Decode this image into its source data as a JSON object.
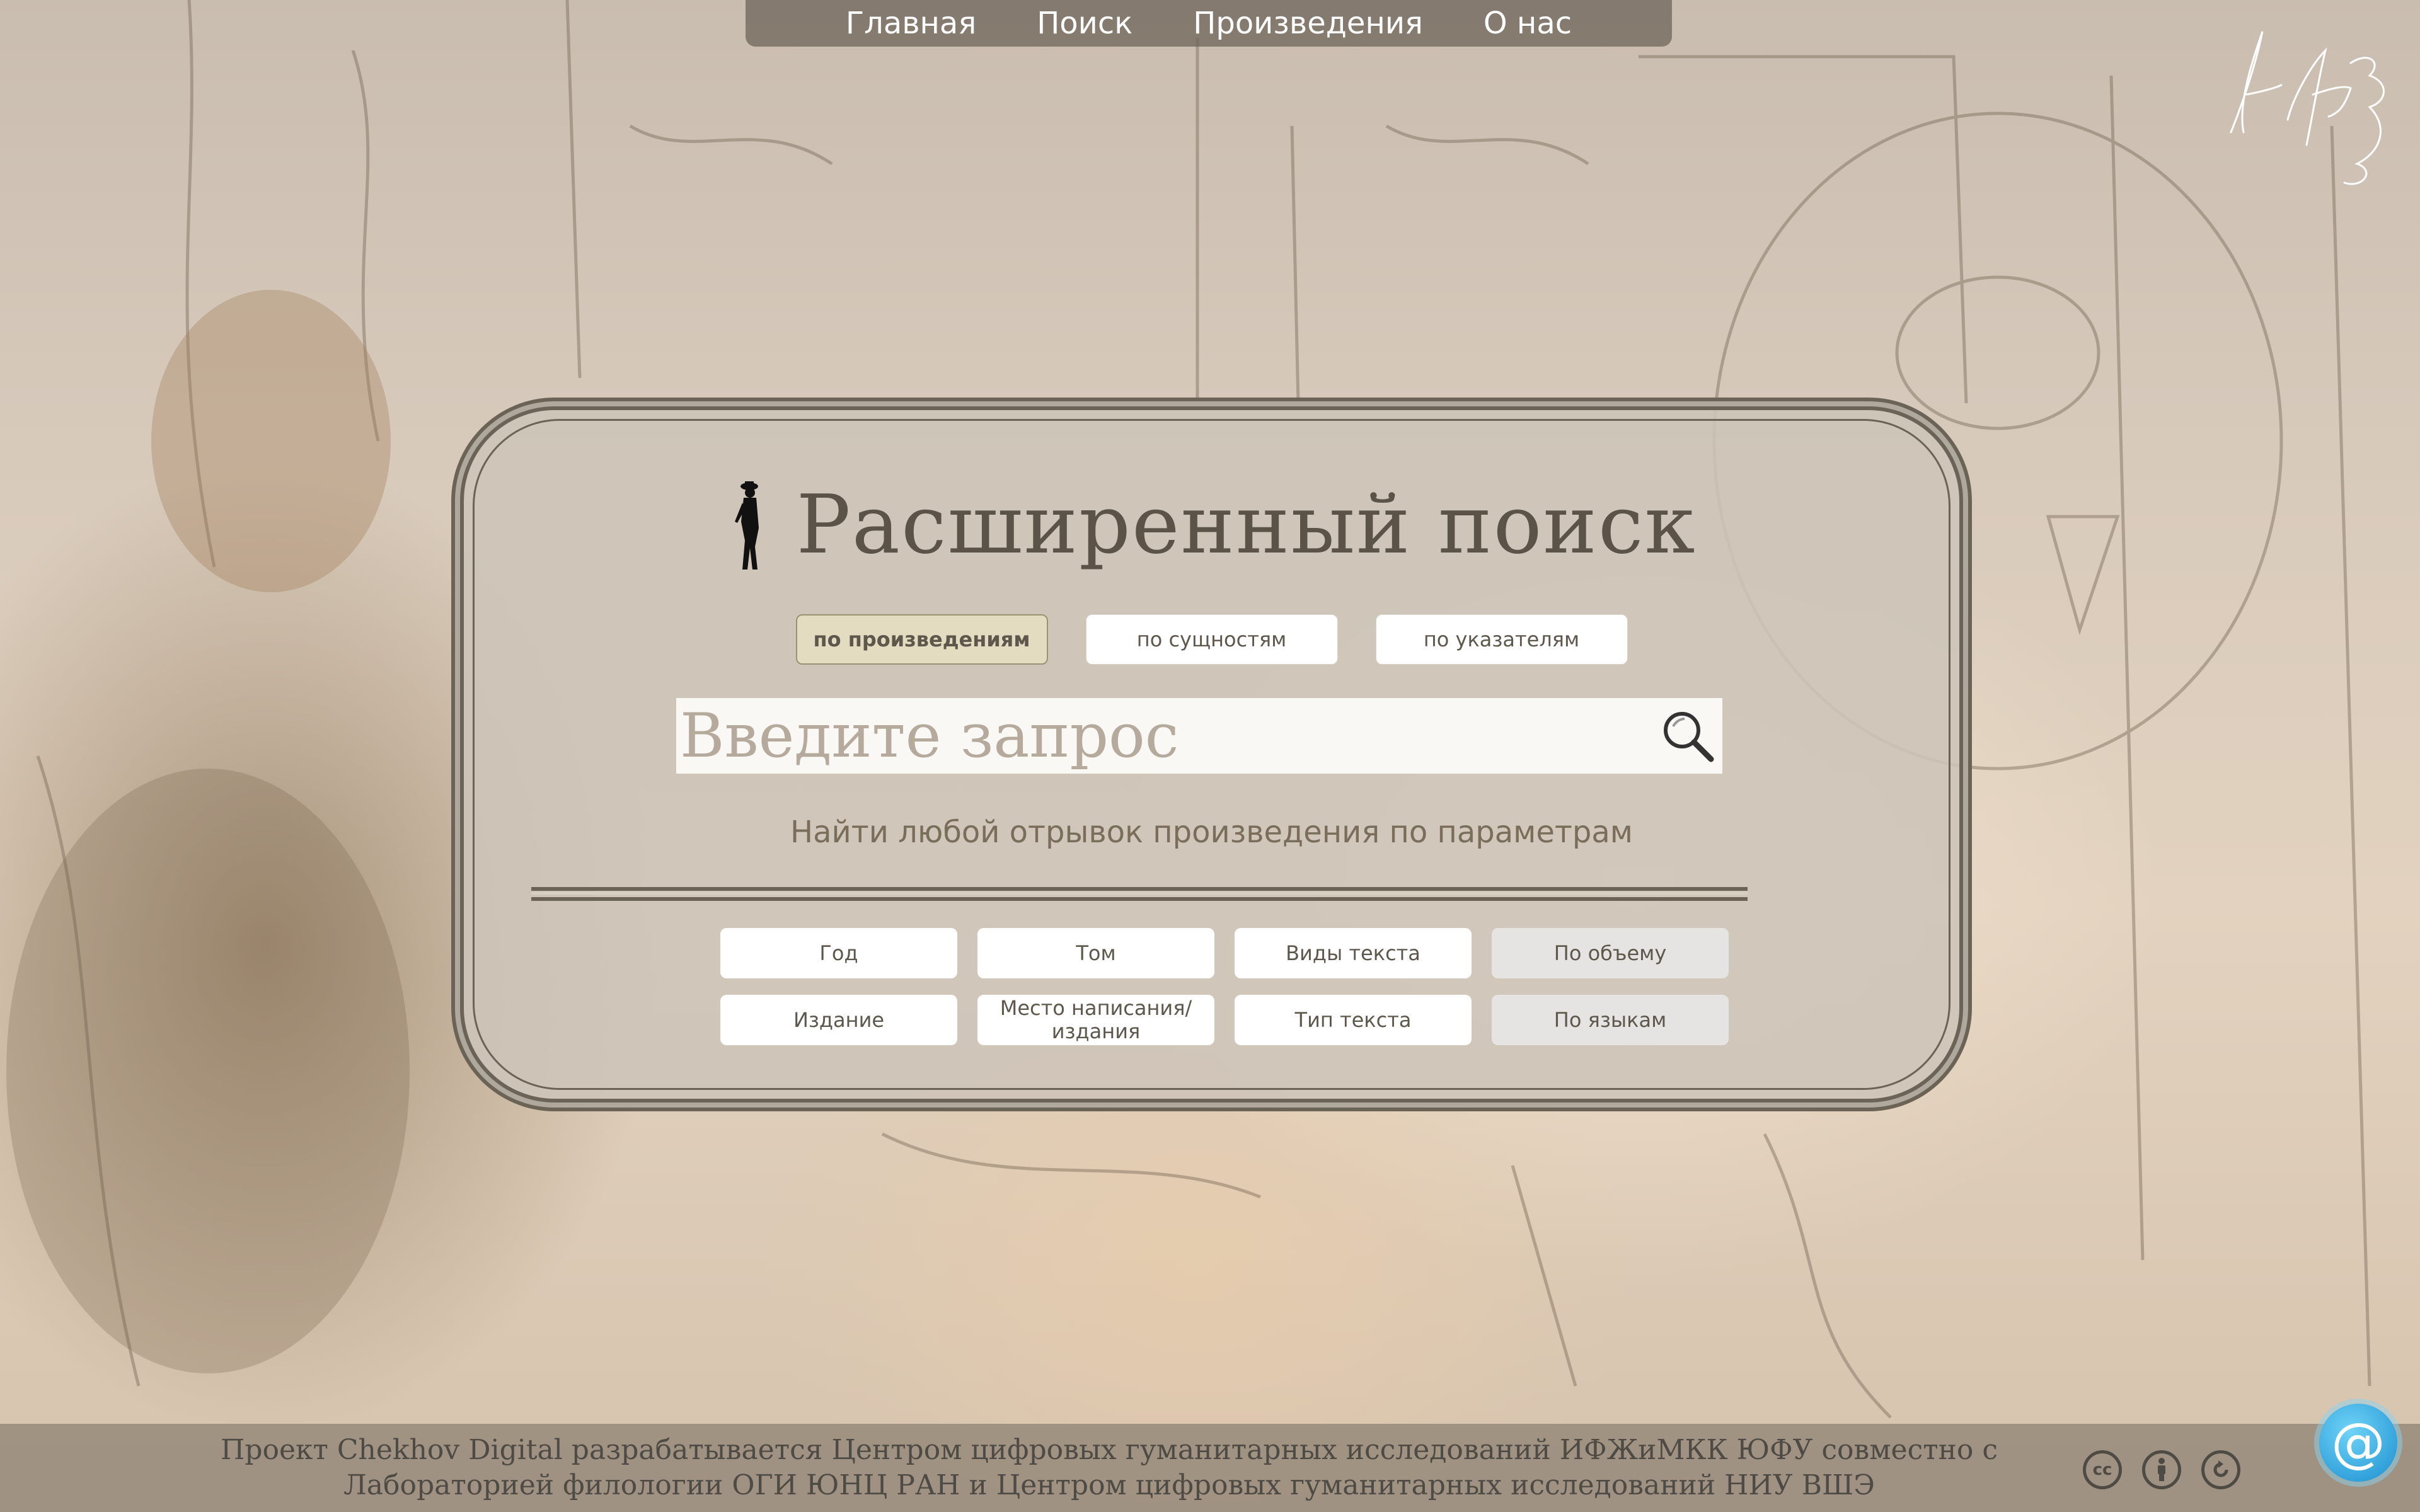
{
  "nav": {
    "items": [
      "Главная",
      "Поиск",
      "Произведения",
      "О нас"
    ]
  },
  "search_page": {
    "title": "Расширенный поиск",
    "tabs": [
      {
        "label": "по произведениям",
        "active": true
      },
      {
        "label": "по сущностям",
        "active": false
      },
      {
        "label": "по указателям",
        "active": false
      }
    ],
    "query": {
      "value": "",
      "placeholder": "Введите запрос"
    },
    "subtitle": "Найти любой отрывок произведения по параметрам",
    "filters": [
      {
        "label": "Год"
      },
      {
        "label": "Том"
      },
      {
        "label": "Виды текста"
      },
      {
        "label": "По объему"
      },
      {
        "label": "Издание"
      },
      {
        "label": "Место написания/издания"
      },
      {
        "label": "Тип текста"
      },
      {
        "label": "По языкам"
      }
    ]
  },
  "footer": {
    "line1": "Проект Chekhov Digital разрабатывается Центром цифровых гуманитарных исследований ИФЖиМКК ЮФУ совместно с",
    "line2": "Лабораторией филологии ОГИ ЮНЦ РАН и Центром цифровых гуманитарных исследований НИУ ВШЭ",
    "icons": [
      "cc-icon",
      "attribution-icon",
      "share-alike-icon"
    ]
  },
  "colors": {
    "accent_text": "#5b5347",
    "active_tab": "#e3dcc0",
    "mail_button": "#1b8fd0"
  }
}
